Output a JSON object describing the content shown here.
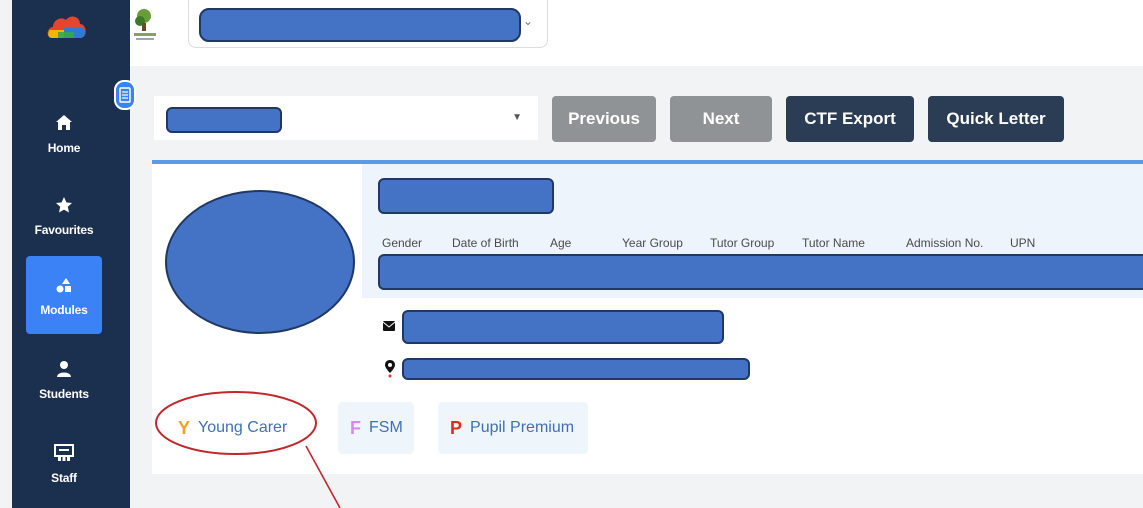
{
  "sidebar": {
    "items": [
      {
        "label": "Home",
        "icon": "home-icon",
        "active": false
      },
      {
        "label": "Favourites",
        "icon": "star-icon",
        "active": false
      },
      {
        "label": "Modules",
        "icon": "modules-icon",
        "active": true
      },
      {
        "label": "Students",
        "icon": "user-icon",
        "active": false
      },
      {
        "label": "Staff",
        "icon": "staff-board-icon",
        "active": false
      }
    ]
  },
  "toolbar": {
    "previous_label": "Previous",
    "next_label": "Next",
    "ctf_export_label": "CTF Export",
    "quick_letter_label": "Quick Letter"
  },
  "profile": {
    "field_headers": [
      "Gender",
      "Date of Birth",
      "Age",
      "Year Group",
      "Tutor Group",
      "Tutor Name",
      "Admission No.",
      "UPN"
    ]
  },
  "tags": [
    {
      "letter": "Y",
      "label": "Young Carer",
      "letter_color": "#f0a020",
      "background": "#ffffff"
    },
    {
      "letter": "F",
      "label": "FSM",
      "letter_color": "#d889e6",
      "background": "#eef6fb"
    },
    {
      "letter": "P",
      "label": "Pupil Premium",
      "letter_color": "#e2281f",
      "background": "#eef6fb"
    }
  ],
  "colors": {
    "sidebar": "#1b2f4f",
    "active_nav": "#3b82f6",
    "redacted_fill": "#4472c4",
    "annotation_red": "#c0282d"
  }
}
